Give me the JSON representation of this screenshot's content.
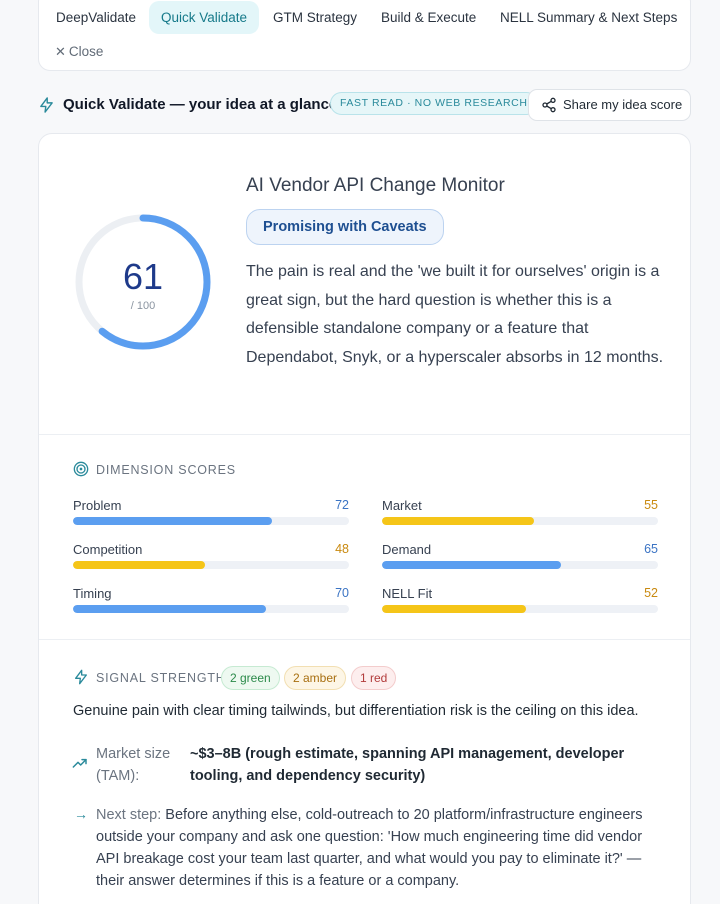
{
  "tabs": [
    {
      "label": "DeepValidate",
      "active": false
    },
    {
      "label": "Quick Validate",
      "active": true
    },
    {
      "label": "GTM Strategy",
      "active": false
    },
    {
      "label": "Build & Execute",
      "active": false
    },
    {
      "label": "NELL Summary & Next Steps",
      "active": false
    }
  ],
  "close_label": "Close",
  "header": {
    "title": "Quick Validate — your idea at a glance",
    "badge": "FAST READ · NO WEB RESEARCH",
    "share_label": "Share my idea score"
  },
  "score": {
    "value": "61",
    "out_of": "/ 100",
    "fraction": 0.61,
    "title": "AI Vendor API Change Monitor",
    "verdict": "Promising with Caveats",
    "summary": "The pain is real and the 'we built it for ourselves' origin is a great sign, but the hard question is whether this is a defensible standalone company or a feature that Dependabot, Snyk, or a hyperscaler absorbs in 12 months."
  },
  "dimensions": {
    "heading": "DIMENSION SCORES",
    "items": [
      {
        "label": "Problem",
        "value": 72,
        "color": "#5b9ef0"
      },
      {
        "label": "Market",
        "value": 55,
        "color": "#f5c518"
      },
      {
        "label": "Competition",
        "value": 48,
        "color": "#f5c518"
      },
      {
        "label": "Demand",
        "value": 65,
        "color": "#5b9ef0"
      },
      {
        "label": "Timing",
        "value": 70,
        "color": "#5b9ef0"
      },
      {
        "label": "NELL Fit",
        "value": 52,
        "color": "#f5c518"
      }
    ]
  },
  "signal": {
    "heading": "SIGNAL STRENGTH",
    "green": "2 green",
    "amber": "2 amber",
    "red": "1 red",
    "text": "Genuine pain with clear timing tailwinds, but differentiation risk is the ceiling on this idea."
  },
  "tam": {
    "label": "Market size (TAM):",
    "value": "~$3–8B (rough estimate, spanning API management, developer tooling, and dependency security)"
  },
  "next_step": {
    "label": "Next step:",
    "text": " Before anything else, cold-outreach to 20 platform/infrastructure engineers outside your company and ask one question: 'How much engineering time did vendor API breakage cost your team last quarter, and what would you pay to eliminate it?' — their answer determines if this is a feature or a company."
  },
  "colors": {
    "blue": "#5b9ef0",
    "amber": "#f5c518",
    "teal": "#2a8a9b",
    "blue_value_text": "#3b74c4",
    "amber_value_text": "#c98a10"
  }
}
